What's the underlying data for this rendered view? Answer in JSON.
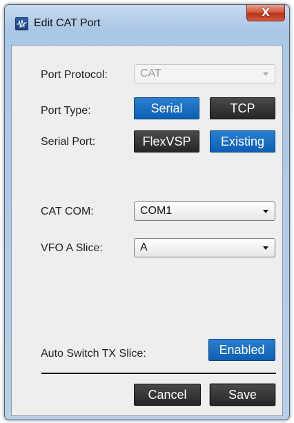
{
  "window": {
    "title": "Edit CAT Port",
    "icon_name": "cat-app-icon",
    "icon_text": "CAT",
    "close_glyph": "X"
  },
  "form": {
    "port_protocol": {
      "label": "Port Protocol:",
      "value": "CAT"
    },
    "port_type": {
      "label": "Port Type:",
      "options": [
        "Serial",
        "TCP"
      ],
      "selected": "Serial"
    },
    "serial_port": {
      "label": "Serial Port:",
      "options": [
        "FlexVSP",
        "Existing"
      ],
      "selected": "Existing"
    },
    "cat_com": {
      "label": "CAT COM:",
      "value": "COM1"
    },
    "vfo_a_slice": {
      "label": "VFO A Slice:",
      "value": "A"
    },
    "auto_switch": {
      "label": "Auto Switch TX Slice:",
      "button": "Enabled"
    }
  },
  "actions": {
    "cancel": "Cancel",
    "save": "Save"
  },
  "colors": {
    "accent_blue": "#0d5fb4",
    "dark_button": "#262626",
    "panel": "#eeeeee"
  }
}
